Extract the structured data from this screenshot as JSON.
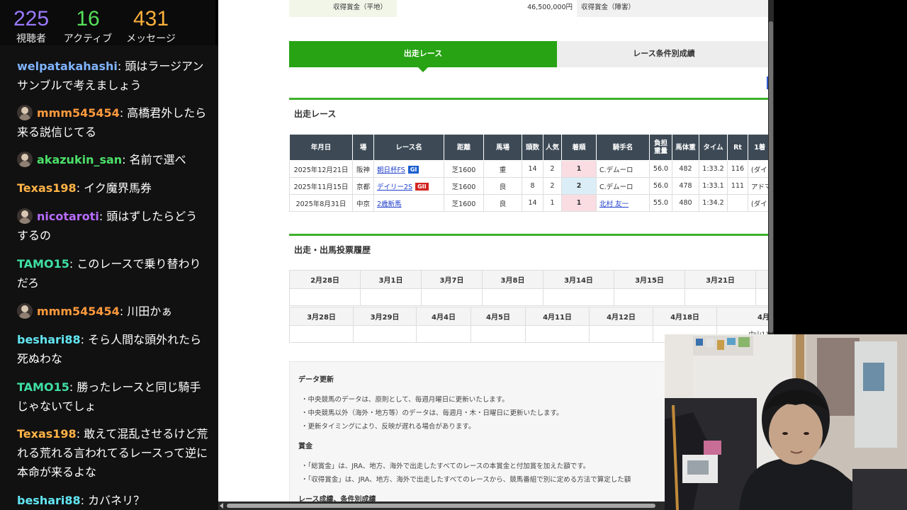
{
  "stats": {
    "viewers": {
      "value": "225",
      "label": "視聴者",
      "color": "#9b79ff"
    },
    "active": {
      "value": "16",
      "label": "アクティブ",
      "color": "#54e05a"
    },
    "messages": {
      "value": "431",
      "label": "メッセージ",
      "color": "#ffb13b"
    }
  },
  "chat": [
    {
      "user": "welpatakahashi",
      "color": "#7fb3ff",
      "avatar": false,
      "text": ": 頭はラージアンサンブルで考えましょう"
    },
    {
      "user": "mmm545454",
      "color": "#ff9a3d",
      "avatar": true,
      "text": ": 高橋君外したら来る説信じてる"
    },
    {
      "user": "akazukin_san",
      "color": "#4ce06a",
      "avatar": true,
      "text": ": 名前で選べ"
    },
    {
      "user": "Texas198",
      "color": "#ffb347",
      "avatar": false,
      "text": ": イク魔界馬券"
    },
    {
      "user": "nicotaroti",
      "color": "#b76cff",
      "avatar": true,
      "text": ": 頭はずしたらどうするの"
    },
    {
      "user": "TAMO15",
      "color": "#3fe0a4",
      "avatar": false,
      "text": ": このレースで乗り替わりだろ"
    },
    {
      "user": "mmm545454",
      "color": "#ff9a3d",
      "avatar": true,
      "text": ": 川田かぁ"
    },
    {
      "user": "beshari88",
      "color": "#62e6f2",
      "avatar": false,
      "text": ": そら人間な頭外れたら死ぬわな"
    },
    {
      "user": "TAMO15",
      "color": "#3fe0a4",
      "avatar": false,
      "text": ": 勝ったレースと同じ騎手じゃないでしょ"
    },
    {
      "user": "Texas198",
      "color": "#ffb347",
      "avatar": false,
      "text": ": 敢えて混乱させるけど荒れる荒れる言われてるレースって逆に本命が来るよな"
    },
    {
      "user": "beshari88",
      "color": "#62e6f2",
      "avatar": false,
      "text": ": カバネリ？"
    }
  ],
  "earnings": {
    "flat_label": "収得賞金（平地）",
    "flat_value": "46,500,000円",
    "jump_label": "収得賞金（障害）"
  },
  "tabs": [
    {
      "label": "出走レース",
      "active": true
    },
    {
      "label": "レース条件別成績",
      "active": false
    }
  ],
  "races_section_title": "出走レース",
  "races_table": {
    "headers": [
      "年月日",
      "場",
      "レース名",
      "距離",
      "馬場",
      "頭数",
      "人気",
      "着順",
      "騎手名",
      "負担\n重量",
      "馬体重",
      "タイム",
      "Rt",
      "1着"
    ],
    "rows": [
      {
        "date": "2025年12月21日",
        "venue": "阪神",
        "race": "朝日杯FS",
        "grade": "GI",
        "grade_color": "#1b5fd0",
        "distance": "芝1600",
        "going": "重",
        "runners": "14",
        "pop": "2",
        "finish": "1",
        "jockey": "C.デムーロ",
        "jockey_link": false,
        "weight": "56.0",
        "body": "482",
        "time": "1:33.2",
        "rt": "116",
        "winner": "(ダイ"
      },
      {
        "date": "2025年11月15日",
        "venue": "京都",
        "race": "デイリー2S",
        "grade": "GII",
        "grade_color": "#d2231f",
        "distance": "芝1600",
        "going": "良",
        "runners": "8",
        "pop": "2",
        "finish": "2",
        "jockey": "C.デムーロ",
        "jockey_link": false,
        "weight": "56.0",
        "body": "478",
        "time": "1:33.1",
        "rt": "111",
        "winner": "アドマ"
      },
      {
        "date": "2025年8月31日",
        "venue": "中京",
        "race": "2歳新馬",
        "grade": "",
        "grade_color": "",
        "distance": "芝1600",
        "going": "良",
        "runners": "14",
        "pop": "1",
        "finish": "1",
        "jockey": "北村 友一",
        "jockey_link": true,
        "weight": "55.0",
        "body": "480",
        "time": "1:34.2",
        "rt": "",
        "winner": "(ダイ"
      }
    ]
  },
  "history_section_title": "出走・出馬投票履歴",
  "history_row1": [
    "2月28日",
    "3月1日",
    "3月7日",
    "3月8日",
    "3月14日",
    "3月15日",
    "3月21日"
  ],
  "history_row2": [
    "3月28日",
    "3月29日",
    "4月4日",
    "4月5日",
    "4月11日",
    "4月12日",
    "4月18日",
    "4月"
  ],
  "history_note": "中山11",
  "info": {
    "update_title": "データ更新",
    "update_items": [
      "・中央競馬のデータは、原則として、毎週月曜日に更新いたします。",
      "・中央競馬以外（海外・地方等）のデータは、毎週月・木・日曜日に更新いたします。",
      "・更新タイミングにより、反映が遅れる場合があります。"
    ],
    "prize_title": "賞金",
    "prize_items": [
      "・「総賞金」は、JRA、地方、海外で出走したすべてのレースの本賞金と付加賞を加えた額です。",
      "・「収得賞金」は、JRA、地方、海外で出走したすべてのレースから、競馬番組で別に定める方法で算定した額"
    ],
    "results_title": "レース成績、条件別成績"
  }
}
